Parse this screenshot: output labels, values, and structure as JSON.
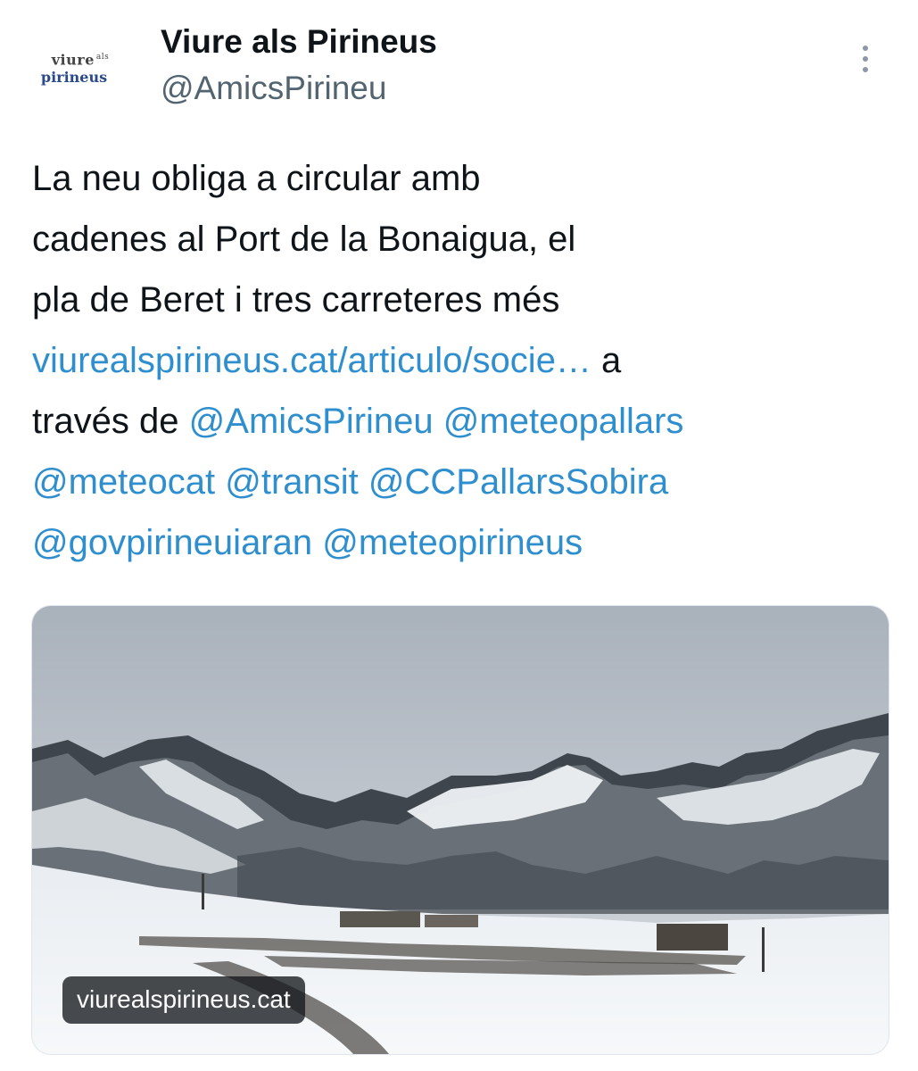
{
  "author": {
    "avatar_line1": "viure",
    "avatar_sup": "als",
    "avatar_line2": "pirineus",
    "display_name": "Viure als Pirineus",
    "handle": "@AmicsPirineu"
  },
  "menu": {
    "icon": "more-vertical-icon"
  },
  "tweet": {
    "line1": "La neu obliga a circular amb",
    "line2": "cadenes al Port de la Bonaigua, el",
    "line3": "pla de Beret i tres carreteres més",
    "link_url": "viurealspirineus.cat/articulo/socie…",
    "text_a": " a",
    "text_traves": "través de ",
    "mentions": [
      "@AmicsPirineu",
      "@meteopallars",
      "@meteocat",
      "@transit",
      "@CCPallarsSobira",
      "@govpirineuiaran",
      "@meteopirineus"
    ]
  },
  "card": {
    "domain": "viurealspirineus.cat"
  },
  "colors": {
    "link": "#2f8fce",
    "text": "#0f1419",
    "secondary": "#536471"
  }
}
